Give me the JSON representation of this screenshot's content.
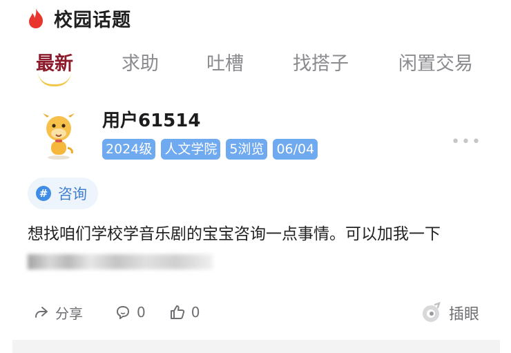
{
  "header": {
    "title": "校园话题",
    "icon": "flame-icon",
    "icon_color": "#e8362f"
  },
  "tabs": [
    {
      "label": "最新",
      "active": true
    },
    {
      "label": "求助",
      "active": false
    },
    {
      "label": "吐槽",
      "active": false
    },
    {
      "label": "找搭子",
      "active": false
    },
    {
      "label": "闲置交易",
      "active": false
    }
  ],
  "post": {
    "username": "用户61514",
    "tags": [
      "2024级",
      "人文学院",
      "5浏览",
      "06/04"
    ],
    "topic": "咨询",
    "content": "想找咱们学校学音乐剧的宝宝咨询一点事情。可以加我一下",
    "actions": {
      "share_label": "分享",
      "comment_count": "0",
      "like_count": "0",
      "cha_yan_label": "插眼"
    }
  },
  "colors": {
    "active_tab": "#8d1a2b",
    "tag_bg": "#6fa9ef",
    "topic_blue": "#3f8de6",
    "accent_yellow": "#f2c84b"
  }
}
